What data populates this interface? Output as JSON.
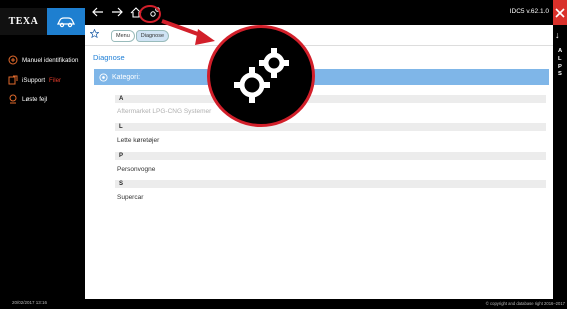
{
  "app": {
    "logo": "TEXA",
    "version": "IDC5 v.62.1.0"
  },
  "sidebar": {
    "items": [
      {
        "label": "Manuel identifikation",
        "icon": "manual-id-icon"
      },
      {
        "label": "iSupport",
        "highlight": "Filer",
        "icon": "isupport-icon"
      },
      {
        "label": "Løste fejl",
        "icon": "solved-faults-icon"
      }
    ],
    "date": "20/02/2017 13:16"
  },
  "breadcrumb": [
    "Menu",
    "Diagnose"
  ],
  "page": {
    "title": "Diagnose",
    "category_label": "Kategori:"
  },
  "groups": [
    {
      "letter": "A",
      "items": [
        "Aftermarket LPG-CNG Systemer"
      ],
      "dim": true
    },
    {
      "letter": "L",
      "items": [
        "Lette køretøjer"
      ],
      "dim": false
    },
    {
      "letter": "P",
      "items": [
        "Personvogne"
      ],
      "dim": false
    },
    {
      "letter": "S",
      "items": [
        "Supercar"
      ],
      "dim": false
    }
  ],
  "index_letters": [
    "A",
    "L",
    "P",
    "S"
  ],
  "footer": "© copyright and database right 2016–2017",
  "colors": {
    "accent": "#1f7fd6",
    "category_bar": "#7fb6e8",
    "close": "#d9302a",
    "callout": "#d21f2a"
  }
}
